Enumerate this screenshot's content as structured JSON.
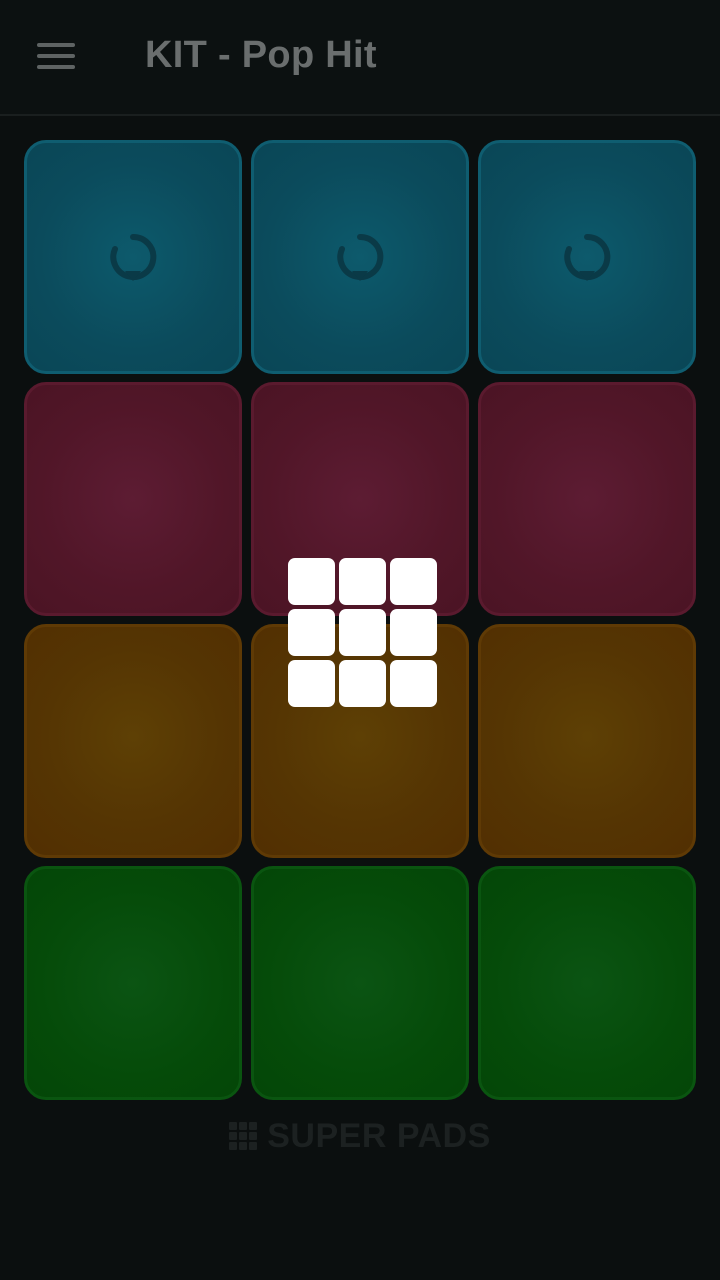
{
  "header": {
    "menu_icon": "hamburger-menu-icon",
    "title": "KIT - Pop Hit"
  },
  "pads": {
    "rows": [
      {
        "color": "blue",
        "hex": "#0b4b5c",
        "icon": "loop-icon"
      },
      {
        "color": "red",
        "hex": "#511628"
      },
      {
        "color": "orange",
        "hex": "#553503"
      },
      {
        "color": "green",
        "hex": "#054b09"
      }
    ],
    "columns": 3
  },
  "loader": {
    "icon": "super-pads-logo-icon",
    "color": "#ffffff"
  },
  "footer": {
    "brand_icon": "super-pads-logo-icon",
    "brand_text": "SUPER PADS"
  }
}
